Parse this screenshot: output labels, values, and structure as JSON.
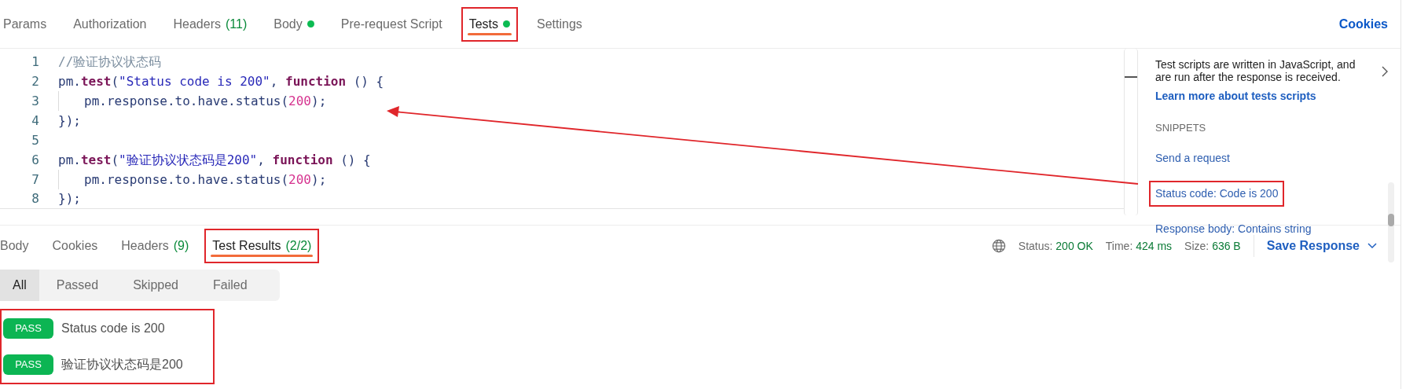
{
  "request_tabs": [
    {
      "label": "Params",
      "selected": false
    },
    {
      "label": "Authorization",
      "selected": false
    },
    {
      "label": "Headers",
      "count": "(11)",
      "selected": false
    },
    {
      "label": "Body",
      "dot": true,
      "selected": false
    },
    {
      "label": "Pre-request Script",
      "selected": false
    },
    {
      "label": "Tests",
      "dot": true,
      "selected": true,
      "annotated": true
    },
    {
      "label": "Settings",
      "selected": false
    }
  ],
  "cookies_link": "Cookies",
  "editor": {
    "lines": [
      {
        "number": "1",
        "indent": false,
        "tokens": [
          {
            "kind": "comment",
            "text": "//验证协议状态码"
          }
        ]
      },
      {
        "number": "2",
        "indent": false,
        "tokens": [
          {
            "kind": "plain",
            "text": "pm."
          },
          {
            "kind": "method",
            "text": "test"
          },
          {
            "kind": "plain",
            "text": "("
          },
          {
            "kind": "string",
            "text": "\"Status code is 200\""
          },
          {
            "kind": "plain",
            "text": ", "
          },
          {
            "kind": "keyword",
            "text": "function"
          },
          {
            "kind": "plain",
            "text": " () {"
          }
        ]
      },
      {
        "number": "3",
        "indent": true,
        "tokens": [
          {
            "kind": "plain",
            "text": "pm.response.to.have.status("
          },
          {
            "kind": "number",
            "text": "200"
          },
          {
            "kind": "plain",
            "text": ");"
          }
        ]
      },
      {
        "number": "4",
        "indent": false,
        "tokens": [
          {
            "kind": "plain",
            "text": "});"
          }
        ]
      },
      {
        "number": "5",
        "indent": false
      },
      {
        "number": "6",
        "indent": false,
        "tokens": [
          {
            "kind": "plain",
            "text": "pm."
          },
          {
            "kind": "method",
            "text": "test"
          },
          {
            "kind": "plain",
            "text": "("
          },
          {
            "kind": "string",
            "text": "\"验证协议状态码是200\""
          },
          {
            "kind": "plain",
            "text": ", "
          },
          {
            "kind": "keyword",
            "text": "function"
          },
          {
            "kind": "plain",
            "text": " () {"
          }
        ]
      },
      {
        "number": "7",
        "indent": true,
        "tokens": [
          {
            "kind": "plain",
            "text": "pm.response.to.have.status("
          },
          {
            "kind": "number",
            "text": "200"
          },
          {
            "kind": "plain",
            "text": ");"
          }
        ]
      },
      {
        "number": "8",
        "indent": false,
        "tokens": [
          {
            "kind": "plain",
            "text": "});"
          }
        ]
      }
    ]
  },
  "side_panel": {
    "description": "Test scripts are written in JavaScript, and are run after the response is received.",
    "learn_more": "Learn more about tests scripts",
    "snippets_heading": "SNIPPETS",
    "snippets": [
      {
        "label": "Send a request",
        "annotated": false
      },
      {
        "label": "Status code: Code is 200",
        "annotated": true
      },
      {
        "label": "Response body: Contains string",
        "annotated": false
      }
    ]
  },
  "response_tabs": [
    {
      "label": "Body",
      "selected": false
    },
    {
      "label": "Cookies",
      "selected": false
    },
    {
      "label": "Headers",
      "count": "(9)",
      "selected": false
    },
    {
      "label": "Test Results",
      "count": "(2/2)",
      "selected": true,
      "annotated": true
    }
  ],
  "response_meta": [
    {
      "label": "Status:",
      "value": "200 OK"
    },
    {
      "label": "Time:",
      "value": "424 ms"
    },
    {
      "label": "Size:",
      "value": "636 B"
    }
  ],
  "save_response": "Save Response",
  "filters": [
    {
      "label": "All",
      "selected": true
    },
    {
      "label": "Passed",
      "selected": false
    },
    {
      "label": "Skipped",
      "selected": false
    },
    {
      "label": "Failed",
      "selected": false
    }
  ],
  "results_annotated": true,
  "results": [
    {
      "status": "PASS",
      "name": "Status code is 200"
    },
    {
      "status": "PASS",
      "name": "验证协议状态码是200"
    }
  ]
}
